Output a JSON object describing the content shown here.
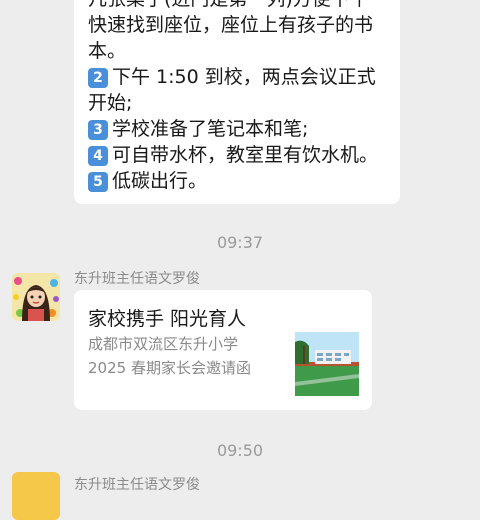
{
  "message1": {
    "lines": [
      "几张桌子(进门是第一列)方便下午",
      "快速找到座位，座位上有孩子的书",
      "本。",
      "下午 1:50 到校，两点会议正式",
      "开始;",
      "学校准备了笔记本和笔;",
      "可自带水杯，教室里有饮水机。",
      "低碳出行。"
    ],
    "numbers": [
      "2",
      "3",
      "4",
      "5"
    ],
    "number_color": "#4a8fd9"
  },
  "timestamp1": "09:37",
  "sender1": "东升班主任语文罗俊",
  "card": {
    "title": "家校携手 阳光育人",
    "desc_line1": "成都市双流区东升小学",
    "desc_line2": "2025 春期家长会邀请函",
    "thumb_icon": "school-building-image"
  },
  "timestamp2": "09:50",
  "sender2": "东升班主任语文罗俊"
}
